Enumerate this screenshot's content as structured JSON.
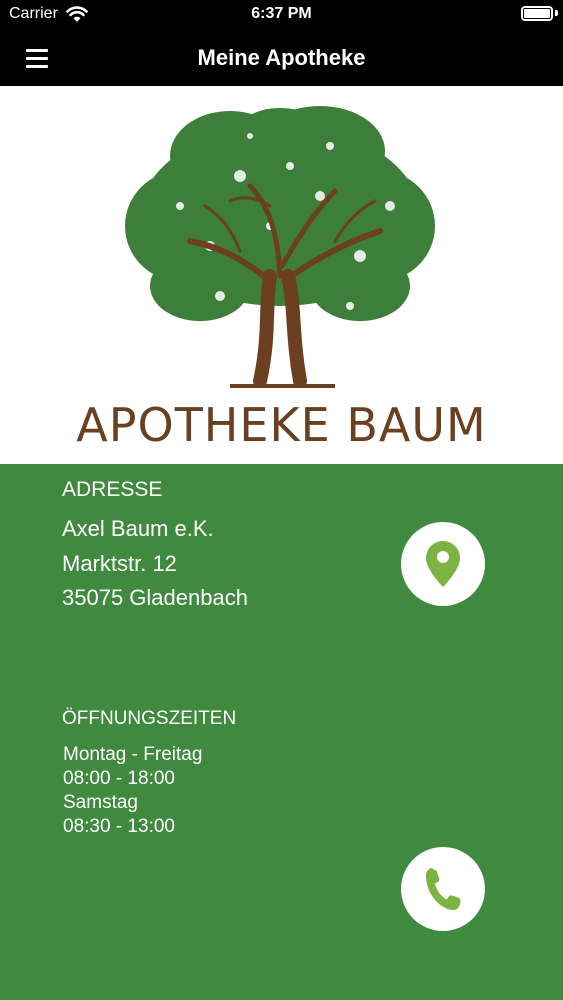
{
  "status_bar": {
    "carrier": "Carrier",
    "time": "6:37 PM"
  },
  "nav": {
    "title": "Meine Apotheke"
  },
  "logo": {
    "text": "APOTHEKE BAUM"
  },
  "address": {
    "heading": "ADRESSE",
    "lines": [
      "Axel Baum e.K.",
      "Marktstr. 12",
      "35075 Gladenbach"
    ]
  },
  "opening_hours": {
    "heading": "ÖFFNUNGSZEITEN",
    "lines": [
      "Montag - Freitag",
      "08:00 - 18:00",
      "Samstag",
      "08:30 - 13:00"
    ]
  },
  "icons": {
    "menu": "hamburger-menu-icon",
    "map": "map-pin-icon",
    "phone": "phone-icon"
  },
  "colors": {
    "primary_green": "#3f8a3e",
    "icon_green": "#7cb342",
    "logo_brown": "#6b3f1f",
    "header": "#000000"
  }
}
